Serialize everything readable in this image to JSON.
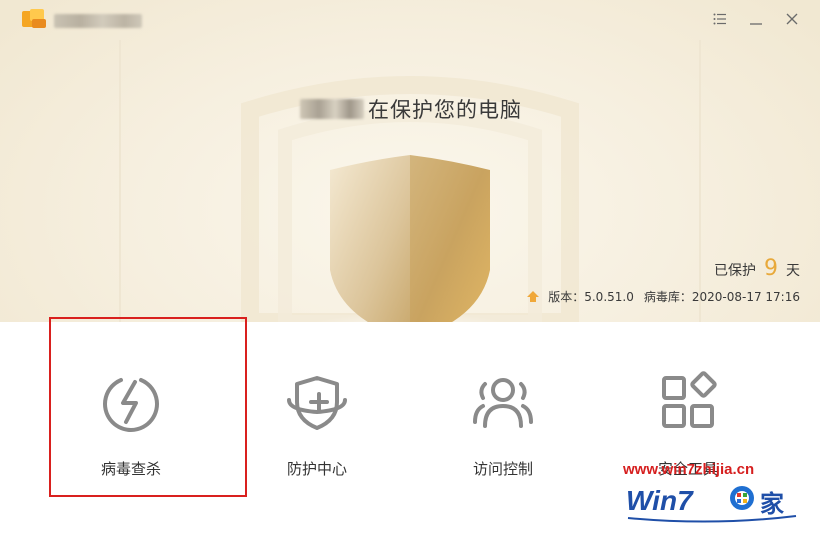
{
  "window": {
    "menu_icon": "menu-list-icon",
    "minimize_icon": "minimize-icon",
    "close_icon": "close-icon"
  },
  "header": {
    "headline_suffix": "在保护您的电脑"
  },
  "status": {
    "protected_prefix": "已保护",
    "protected_days": "9",
    "protected_unit": "天",
    "version_label": "版本：5.0.51.0",
    "virus_db_label": "病毒库：2020-08-17 17:16"
  },
  "features": [
    {
      "label": "病毒查杀",
      "icon": "lightning-circle-icon"
    },
    {
      "label": "防护中心",
      "icon": "shield-plus-icon"
    },
    {
      "label": "访问控制",
      "icon": "users-icon"
    },
    {
      "label": "安全工具",
      "icon": "apps-grid-icon"
    }
  ],
  "watermark": {
    "url": "www.win7zhijia.cn",
    "brand": "Win7",
    "brand_suffix": "家"
  },
  "colors": {
    "accent": "#e8a93b",
    "highlight_border": "#d9201e",
    "icon_gray": "#8a8a8a"
  }
}
